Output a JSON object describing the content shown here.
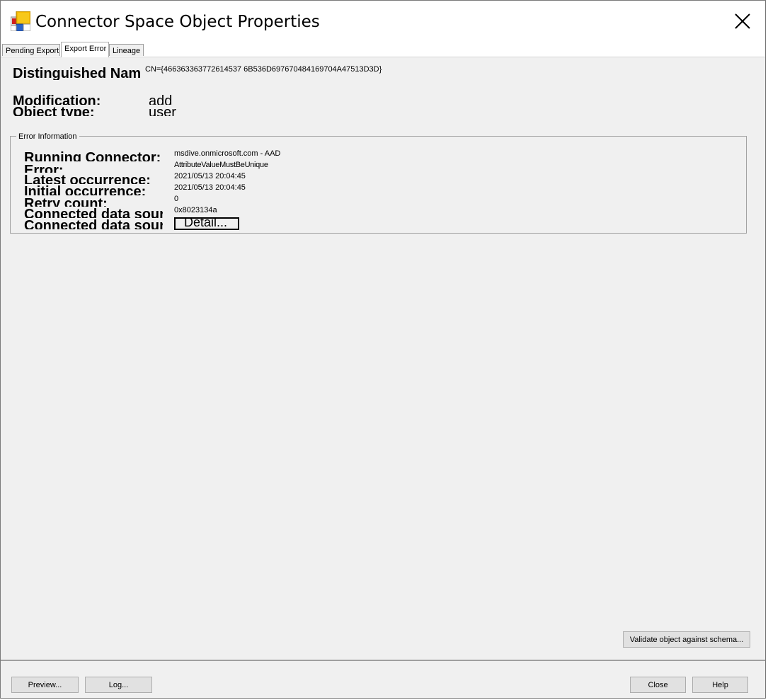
{
  "window": {
    "title": "Connector Space Object Properties"
  },
  "tabs": [
    {
      "label": "Pending Export",
      "active": false
    },
    {
      "label": "Export Error",
      "active": true
    },
    {
      "label": "Lineage",
      "active": false
    }
  ],
  "object": {
    "dn_label": "Distinguished Name:",
    "dn_value": "CN={466363363772614537 6B536D697670484169704A47513D3D}",
    "modification_label": "Modification:",
    "modification_value": "add",
    "object_type_label": "Object type:",
    "object_type_value": "user"
  },
  "error_info": {
    "group_title": "Error Information",
    "fields": [
      {
        "label": "Running Connector:",
        "value": "msdive.onmicrosoft.com - AAD"
      },
      {
        "label": "Error:",
        "value": "AttributeValueMustBeUnique"
      },
      {
        "label": "Latest occurrence:",
        "value": "2021/05/13 20:04:45"
      },
      {
        "label": "Initial occurrence:",
        "value": "2021/05/13 20:04:45"
      },
      {
        "label": "Retry count:",
        "value": "0"
      },
      {
        "label": "Connected data source error code:",
        "value": "0x8023134a"
      },
      {
        "label": "Connected data source error:",
        "value": ""
      }
    ],
    "detail_button": "Detail..."
  },
  "buttons": {
    "validate": "Validate object against schema...",
    "preview": "Preview...",
    "log": "Log...",
    "close": "Close",
    "help": "Help"
  },
  "colors": {
    "panel_bg": "#f0f0f0",
    "button_bg": "#e1e1e1",
    "titlebar_bg": "#ffffff"
  },
  "icons": {
    "app_icon": "connector-space-app-icon",
    "close": "close-x-icon"
  }
}
